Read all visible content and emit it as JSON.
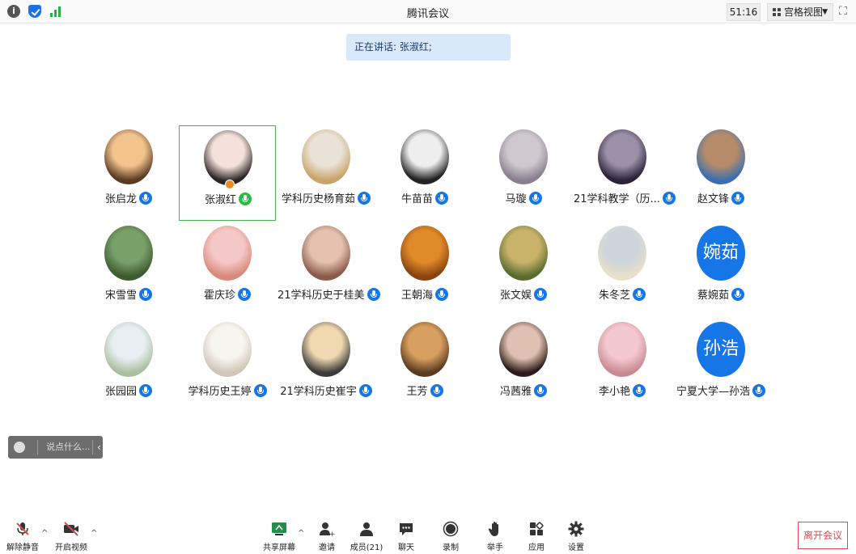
{
  "window": {
    "title": "腾讯会议",
    "timer": "51:16",
    "view_mode": "宫格视图"
  },
  "speaking": {
    "text": "正在讲话: 张淑红;"
  },
  "participants": [
    {
      "name": "张启龙",
      "avatar": "photo",
      "mic": "blue"
    },
    {
      "name": "张淑红",
      "avatar": "photo",
      "mic": "green",
      "active": true
    },
    {
      "name": "学科历史杨育茹",
      "avatar": "photo",
      "mic": "blue"
    },
    {
      "name": "牛苗苗",
      "avatar": "photo",
      "mic": "blue"
    },
    {
      "name": "马璇",
      "avatar": "photo",
      "mic": "blue"
    },
    {
      "name": "21学科教学（历...",
      "avatar": "photo",
      "mic": "blue"
    },
    {
      "name": "赵文锋",
      "avatar": "photo",
      "mic": "blue"
    },
    {
      "name": "宋雪雪",
      "avatar": "photo",
      "mic": "blue"
    },
    {
      "name": "霍庆珍",
      "avatar": "photo",
      "mic": "blue"
    },
    {
      "name": "21学科历史于桂美",
      "avatar": "photo",
      "mic": "blue"
    },
    {
      "name": "王朝海",
      "avatar": "photo",
      "mic": "blue"
    },
    {
      "name": "张文娱",
      "avatar": "photo",
      "mic": "blue"
    },
    {
      "name": "朱冬芝",
      "avatar": "photo",
      "mic": "blue"
    },
    {
      "name": "蔡婉茹",
      "avatar": "text",
      "avatar_text": "婉茹",
      "mic": "blue"
    },
    {
      "name": "张园园",
      "avatar": "photo",
      "mic": "blue"
    },
    {
      "name": "学科历史王婷",
      "avatar": "photo",
      "mic": "blue"
    },
    {
      "name": "21学科历史崔宇",
      "avatar": "photo",
      "mic": "blue"
    },
    {
      "name": "王芳",
      "avatar": "photo",
      "mic": "blue"
    },
    {
      "name": "冯茜雅",
      "avatar": "photo",
      "mic": "blue"
    },
    {
      "name": "李小艳",
      "avatar": "photo",
      "mic": "blue"
    },
    {
      "name": "宁夏大学—孙浩",
      "avatar": "text",
      "avatar_text": "孙浩",
      "mic": "blue"
    }
  ],
  "chat": {
    "placeholder": "说点什么..."
  },
  "toolbar": {
    "unmute": "解除静音",
    "start_video": "开启视频",
    "share_screen": "共享屏幕",
    "invite": "邀请",
    "members": "成员(21)",
    "chat": "聊天",
    "record": "录制",
    "raise_hand": "举手",
    "apps": "应用",
    "settings": "设置",
    "leave": "离开会议"
  },
  "colors": {
    "accent": "#1676e8",
    "active_border": "#4caf50",
    "leave": "#e04a4a"
  }
}
